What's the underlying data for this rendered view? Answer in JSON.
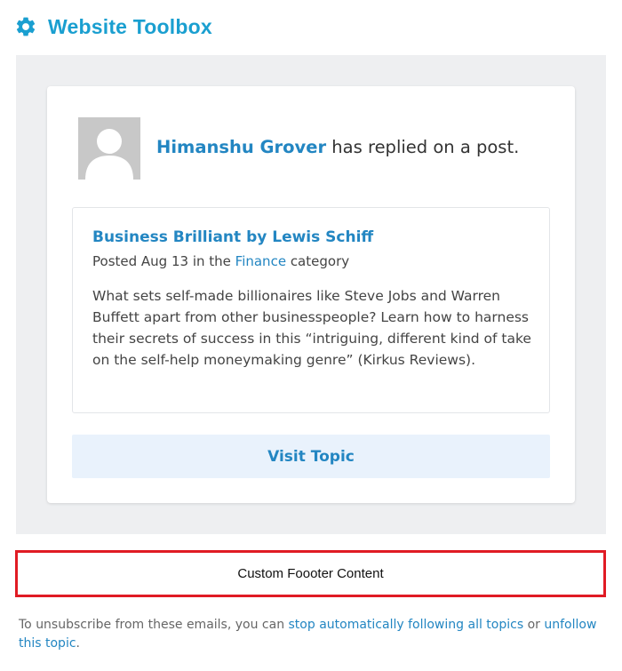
{
  "header": {
    "brand": "Website Toolbox",
    "icon": "gear-icon",
    "brand_color": "#1a9fd0"
  },
  "notification": {
    "user_name": "Himanshu Grover",
    "action_text": " has replied on a post.",
    "avatar_icon": "user-avatar-icon"
  },
  "post": {
    "title": "Business Brilliant by Lewis Schiff",
    "meta_prefix": "Posted Aug 13 in the ",
    "category": "Finance",
    "meta_suffix": " category",
    "body": "What sets self-made billionaires like Steve Jobs and Warren Buffett apart from other businesspeople? Learn how to harness their secrets of success in this “intriguing, different kind of take on the self-help moneymaking genre” (Kirkus Reviews)."
  },
  "visit_button": {
    "label": "Visit Topic"
  },
  "custom_footer": {
    "text": "Custom Foooter Content",
    "border_color": "#e01b24"
  },
  "unsubscribe": {
    "prefix": "To unsubscribe from these emails, you can ",
    "link_stop": "stop automatically following all topics",
    "middle": " or ",
    "link_unfollow": "unfollow this topic",
    "suffix": "."
  },
  "colors": {
    "link": "#2386c2",
    "panel_bg": "#eeeff1",
    "button_bg": "#e9f2fc"
  }
}
